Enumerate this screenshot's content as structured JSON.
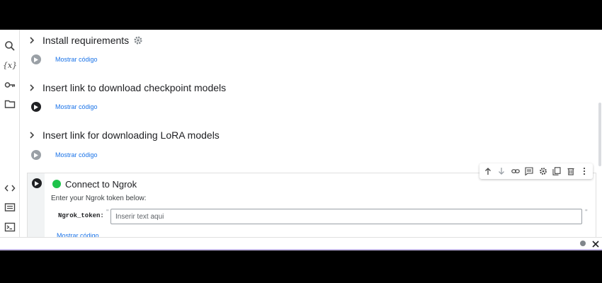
{
  "sidebar": {
    "items": [
      {
        "icon": "search-icon"
      },
      {
        "icon": "variables-icon",
        "glyph": "{x}"
      },
      {
        "icon": "key-icon"
      },
      {
        "icon": "folder-icon"
      },
      {
        "icon": "code-icon"
      },
      {
        "icon": "snippets-icon"
      },
      {
        "icon": "terminal-icon"
      }
    ]
  },
  "sections": [
    {
      "title": "Install requirements",
      "show_code": "Mostrar código"
    },
    {
      "title": "Insert link to download checkpoint models",
      "show_code": "Mostrar código"
    },
    {
      "title": "Insert link for downloading LoRA models",
      "show_code": "Mostrar código"
    }
  ],
  "active_cell": {
    "title": "Connect to Ngrok",
    "description": "Enter your Ngrok token below:",
    "field_label": "Ngrok_token:",
    "quote": "\"",
    "placeholder": "Inserir text aqui",
    "value": "",
    "show_code": "Mostrar código"
  },
  "cell_toolbar": [
    "move-up",
    "move-down",
    "link",
    "comment",
    "settings",
    "mirror",
    "delete",
    "more"
  ],
  "colors": {
    "status_dot": "#1ec34b",
    "link": "#1a73e8",
    "accent_line": "#c5b9e6"
  }
}
